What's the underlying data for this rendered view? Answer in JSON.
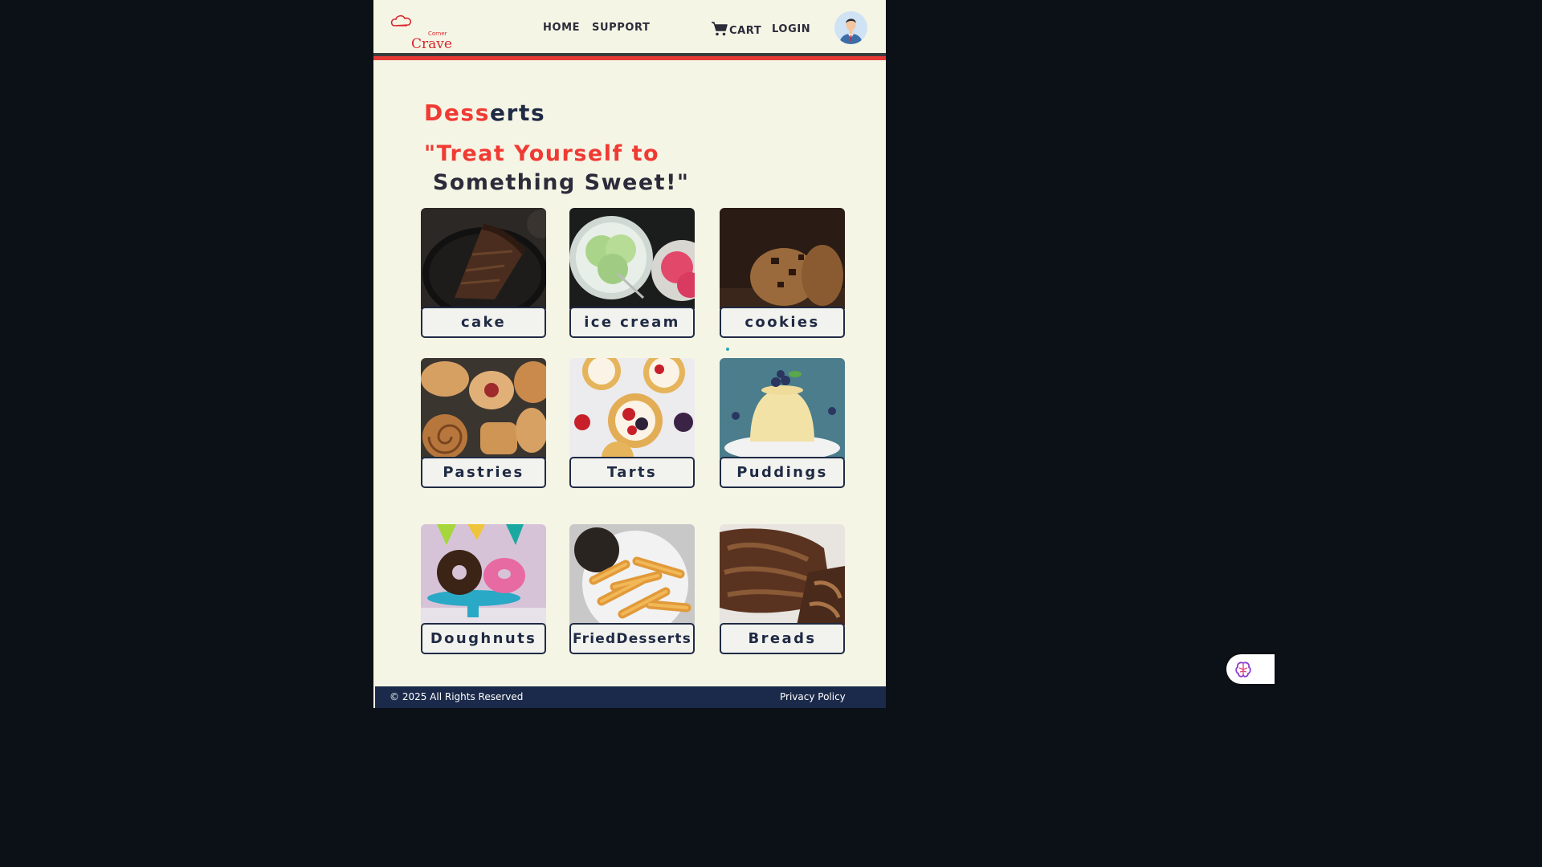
{
  "navbar": {
    "logo_text": "Crave",
    "logo_small": "Corner",
    "home": "HOME",
    "support": "SUPPORT",
    "cart": "CART",
    "login": "LOGIN"
  },
  "heading": {
    "title_red": "Dess",
    "title_rest": "erts",
    "tagline_line1": "\"Treat Yourself to",
    "tagline_line2": " Something Sweet!\""
  },
  "categories": [
    {
      "label": "cake",
      "icon": "cake-image"
    },
    {
      "label": "ice cream",
      "icon": "ice-cream-image"
    },
    {
      "label": "cookies",
      "icon": "cookies-image"
    },
    {
      "label": "Pastries",
      "icon": "pastries-image"
    },
    {
      "label": "Tarts",
      "icon": "tarts-image"
    },
    {
      "label": "Puddings",
      "icon": "puddings-image"
    },
    {
      "label": "Doughnuts",
      "icon": "doughnuts-image"
    },
    {
      "label": "FriedDesserts",
      "icon": "fried-desserts-image"
    },
    {
      "label": "Breads",
      "icon": "breads-image"
    }
  ],
  "footer": {
    "copyright": "© 2025 All Rights Reserved",
    "privacy": "Privacy Policy"
  },
  "colors": {
    "accent_red": "#ef3b33",
    "navy": "#1f2a44",
    "page_bg": "#f5f5e6",
    "footer_bg": "#1b2a4a"
  }
}
